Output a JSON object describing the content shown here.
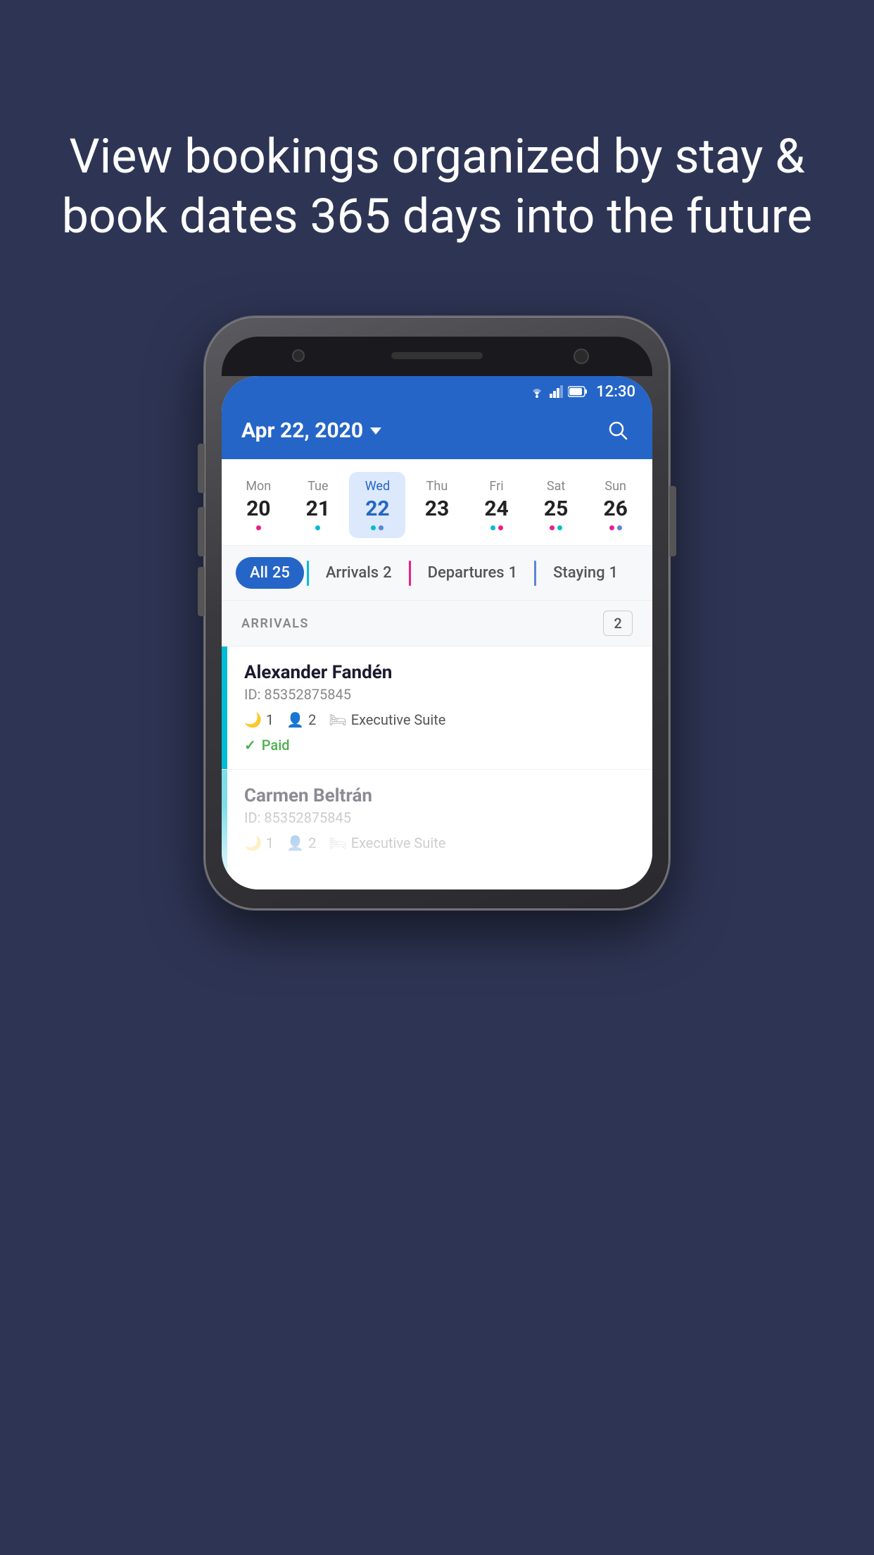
{
  "background_color": "#2e3554",
  "hero": {
    "title": "View bookings organized by stay & book dates 365 days into the future"
  },
  "status_bar": {
    "time": "12:30",
    "wifi": "▼",
    "signal": "▲",
    "battery": "🔋"
  },
  "header": {
    "date": "Apr 22, 2020",
    "dropdown_visible": true,
    "search_label": "search"
  },
  "calendar": {
    "days": [
      {
        "name": "Mon",
        "number": "20",
        "dots": [
          "pink"
        ],
        "selected": false
      },
      {
        "name": "Tue",
        "number": "21",
        "dots": [
          "teal"
        ],
        "selected": false
      },
      {
        "name": "Wed",
        "number": "22",
        "dots": [
          "teal",
          "blue"
        ],
        "selected": true
      },
      {
        "name": "Thu",
        "number": "23",
        "dots": [],
        "selected": false
      },
      {
        "name": "Fri",
        "number": "24",
        "dots": [
          "teal",
          "pink"
        ],
        "selected": false
      },
      {
        "name": "Sat",
        "number": "25",
        "dots": [
          "pink",
          "teal"
        ],
        "selected": false
      },
      {
        "name": "Sun",
        "number": "26",
        "dots": [
          "pink",
          "blue"
        ],
        "selected": false
      }
    ]
  },
  "filter_tabs": [
    {
      "label": "All",
      "count": "25",
      "active": true,
      "color": "#2565c7"
    },
    {
      "label": "Arrivals",
      "count": "2",
      "active": false,
      "sep_color": "teal"
    },
    {
      "label": "Departures",
      "count": "1",
      "active": false,
      "sep_color": "pink"
    },
    {
      "label": "Staying",
      "count": "1",
      "active": false,
      "sep_color": "blue"
    }
  ],
  "sections": [
    {
      "title": "ARRIVALS",
      "count": "2",
      "bookings": [
        {
          "name": "Alexander Fandén",
          "id": "ID: 85352875845",
          "nights": "1",
          "guests": "2",
          "room": "Executive Suite",
          "status": "Paid",
          "bar_color": "#00bcd4"
        },
        {
          "name": "Carmen Beltrán",
          "id": "ID: 85352875845",
          "nights": "1",
          "guests": "2",
          "room": "Executive Suite",
          "status": "",
          "bar_color": "#00bcd4"
        }
      ]
    }
  ],
  "icons": {
    "moon": "🌙",
    "person": "👤",
    "bed": "🛏",
    "check": "✓",
    "search": "⌕",
    "dropdown": "▾"
  }
}
